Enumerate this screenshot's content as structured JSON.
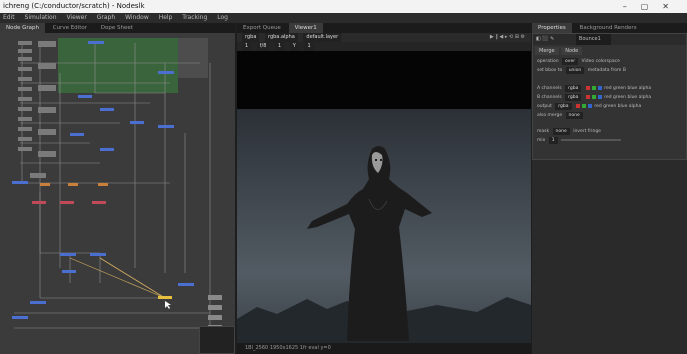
{
  "titlebar": {
    "title": "ichreng (C:/conductor/scratch) - Nodeslk"
  },
  "menu": [
    "Edit",
    "Simulation",
    "Viewer",
    "Graph",
    "Window",
    "Help",
    "Tracking",
    "Log"
  ],
  "graph": {
    "tabs": [
      "Node Graph",
      "Curve Editor",
      "Dope Sheet"
    ]
  },
  "viewer": {
    "tabs": [
      "Export Queue",
      "Viewer1"
    ],
    "toolbar": {
      "channel": "rgba",
      "mode": "rgba.alpha",
      "layer": "default.layer",
      "controls": "▶ ‖ ◀ ▸ ⟲ ⊞ ⚙"
    },
    "toolbar2": {
      "frame": "1",
      "label": "f/8",
      "zoom": "1",
      "ratio": "Y",
      "value": "1"
    },
    "status": "1Bl_2560 1950x1625 1fr eval y=0"
  },
  "props": {
    "tabs": [
      "Properties",
      "Background Renders"
    ],
    "node_name": "Bounce1",
    "subtabs": [
      "Merge",
      "Node"
    ],
    "rows": [
      {
        "label": "operation",
        "value": "over",
        "extra": "Video colorspace"
      },
      {
        "label": "set bbox to",
        "value": "union",
        "extra": "metadata from B"
      },
      {
        "label": "A channels",
        "value": "rgba",
        "flags": "red green blue alpha"
      },
      {
        "label": "B channels",
        "value": "rgba",
        "flags": "red green blue alpha"
      },
      {
        "label": "output",
        "value": "rgba",
        "flags": "red green blue alpha"
      },
      {
        "label": "also merge",
        "value": "none"
      },
      {
        "label": "mask",
        "value": "none",
        "extra": "invert fringe"
      },
      {
        "label": "mix",
        "value": "1"
      }
    ]
  },
  "colors": {
    "node_blue": "#4a6fd1",
    "node_red": "#c04a5a",
    "node_yellow": "#e8c040",
    "grid_green": "#3b6d3d"
  }
}
